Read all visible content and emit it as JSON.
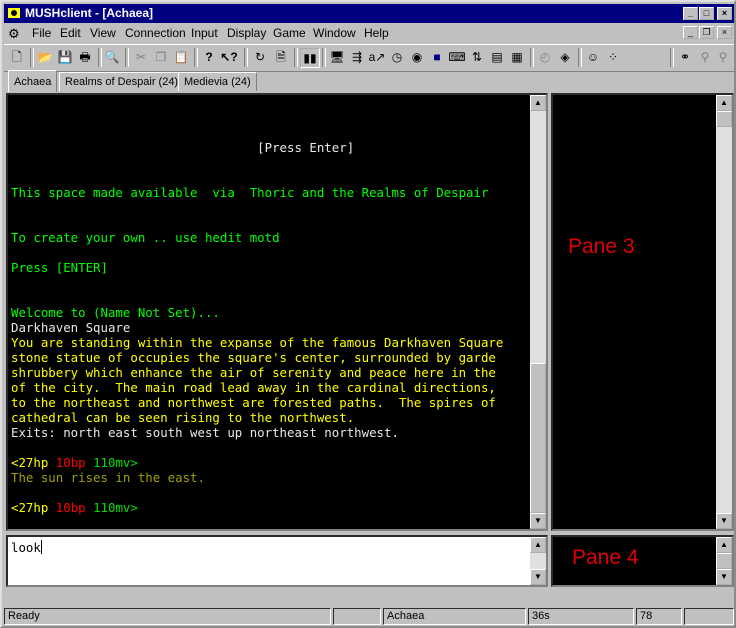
{
  "window": {
    "title": "MUSHclient - [Achaea]",
    "min": "_",
    "max": "□",
    "close": "×"
  },
  "menu": [
    "File",
    "Edit",
    "View",
    "Connection",
    "Input",
    "Display",
    "Game",
    "Window",
    "Help"
  ],
  "mdi": {
    "min": "_",
    "restore": "❐",
    "close": "×"
  },
  "tabs": [
    "Achaea",
    "Realms of Despair (24)",
    "Medievia (24)"
  ],
  "output": {
    "lines": [
      {
        "text": "",
        "c": "w"
      },
      {
        "text": "",
        "c": "w"
      },
      {
        "text": "",
        "c": "w"
      },
      {
        "text": "                                 [Press Enter]",
        "c": "w"
      },
      {
        "text": "",
        "c": "w"
      },
      {
        "text": "",
        "c": "w"
      },
      {
        "text": "This space made available  via  Thoric and the Realms of Despair",
        "c": "g"
      },
      {
        "text": "",
        "c": "w"
      },
      {
        "text": "",
        "c": "w"
      },
      {
        "text": "To create your own .. use hedit motd",
        "c": "g"
      },
      {
        "text": "",
        "c": "w"
      },
      {
        "text": "Press [ENTER]",
        "c": "g"
      },
      {
        "text": "",
        "c": "w"
      },
      {
        "text": "",
        "c": "w"
      },
      {
        "text": "Welcome to (Name Not Set)...",
        "c": "g"
      },
      {
        "text": "Darkhaven Square",
        "c": "w"
      },
      {
        "text": "You are standing within the expanse of the famous Darkhaven Square",
        "c": "y"
      },
      {
        "text": "stone statue of occupies the square's center, surrounded by garde",
        "c": "y"
      },
      {
        "text": "shrubbery which enhance the air of serenity and peace here in the",
        "c": "y"
      },
      {
        "text": "of the city.  The main road lead away in the cardinal directions,",
        "c": "y"
      },
      {
        "text": "to the northeast and northwest are forested paths.  The spires of",
        "c": "y"
      },
      {
        "text": "cathedral can be seen rising to the northwest.",
        "c": "y"
      },
      {
        "text": "Exits: north east south west up northeast northwest.",
        "c": "w"
      },
      {
        "text": "",
        "c": "w"
      },
      {
        "prompt": true,
        "hp": "<27hp",
        "bp": "10bp",
        "mv": "110mv>"
      },
      {
        "text": "The sun rises in the east.",
        "c": "dy"
      },
      {
        "text": "",
        "c": "w"
      },
      {
        "prompt": true,
        "hp": "<27hp",
        "bp": "10bp",
        "mv": "110mv>"
      }
    ]
  },
  "pane3_label": "Pane 3",
  "pane4_label": "Pane 4",
  "input": {
    "value": "look"
  },
  "status": {
    "text": "Ready",
    "world": "Achaea",
    "time": "36s",
    "lines": "78"
  }
}
